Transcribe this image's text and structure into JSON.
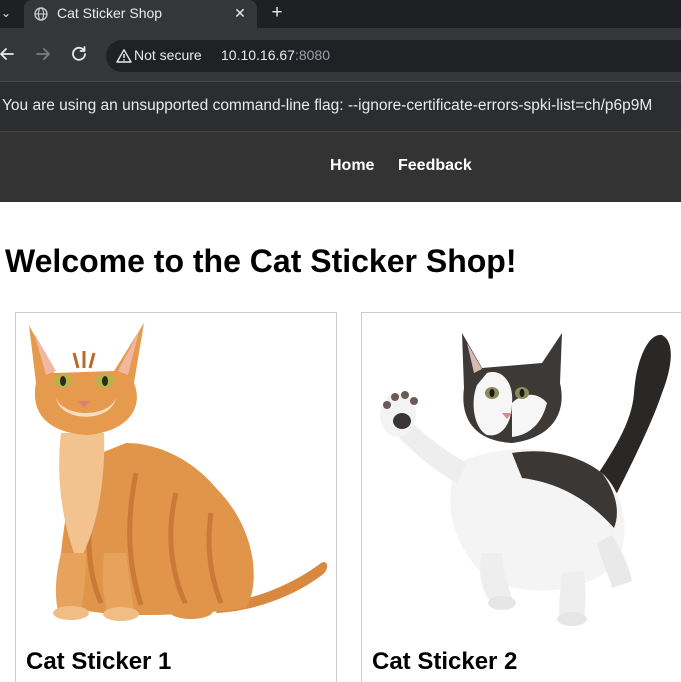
{
  "browser": {
    "tab_title": "Cat Sticker Shop",
    "tab_close_glyph": "✕",
    "new_tab_glyph": "+",
    "security_label": "Not secure",
    "url_host": "10.10.16.67",
    "url_port": ":8080",
    "infobar_message": "You are using an unsupported command-line flag: --ignore-certificate-errors-spki-list=ch/p6p9M"
  },
  "nav": {
    "links": [
      "Home",
      "Feedback"
    ]
  },
  "main": {
    "heading": "Welcome to the Cat Sticker Shop!",
    "products": [
      {
        "title": "Cat Sticker 1"
      },
      {
        "title": "Cat Sticker 2"
      }
    ]
  },
  "colors": {
    "nav_bg": "#333333",
    "card_border": "#cccccc",
    "chrome_toolbar": "#35363a"
  },
  "icons": [
    "globe-icon",
    "close-icon",
    "plus-icon",
    "back-icon",
    "forward-icon",
    "reload-icon",
    "warning-icon"
  ]
}
